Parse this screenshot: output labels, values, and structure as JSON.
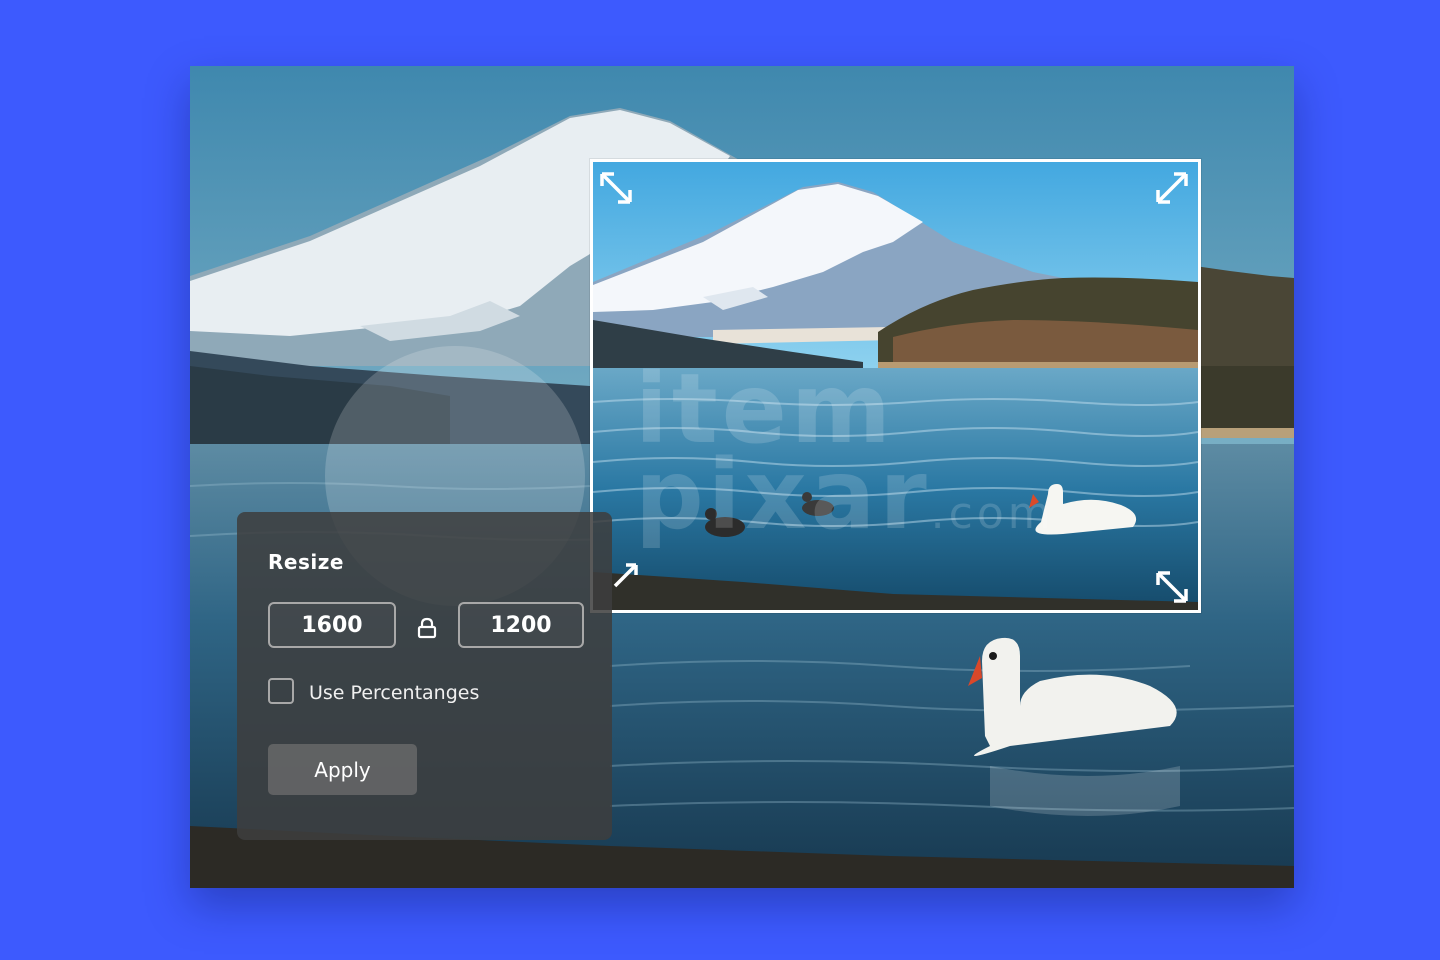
{
  "colors": {
    "background": "#3d5afe",
    "panel": "#3e3e3e",
    "frame_border": "#ffffff"
  },
  "watermark": {
    "line1": "item",
    "line2": "pixar",
    "suffix": ".com"
  },
  "icons": {
    "resize_handles": "diagonal-double-arrow-icon",
    "lock": "lock-icon"
  },
  "resize_panel": {
    "title": "Resize",
    "width_value": "1600",
    "height_value": "1200",
    "aspect_lock": "locked",
    "use_percentages_label": "Use Percentanges",
    "use_percentages_checked": false,
    "apply_label": "Apply"
  }
}
